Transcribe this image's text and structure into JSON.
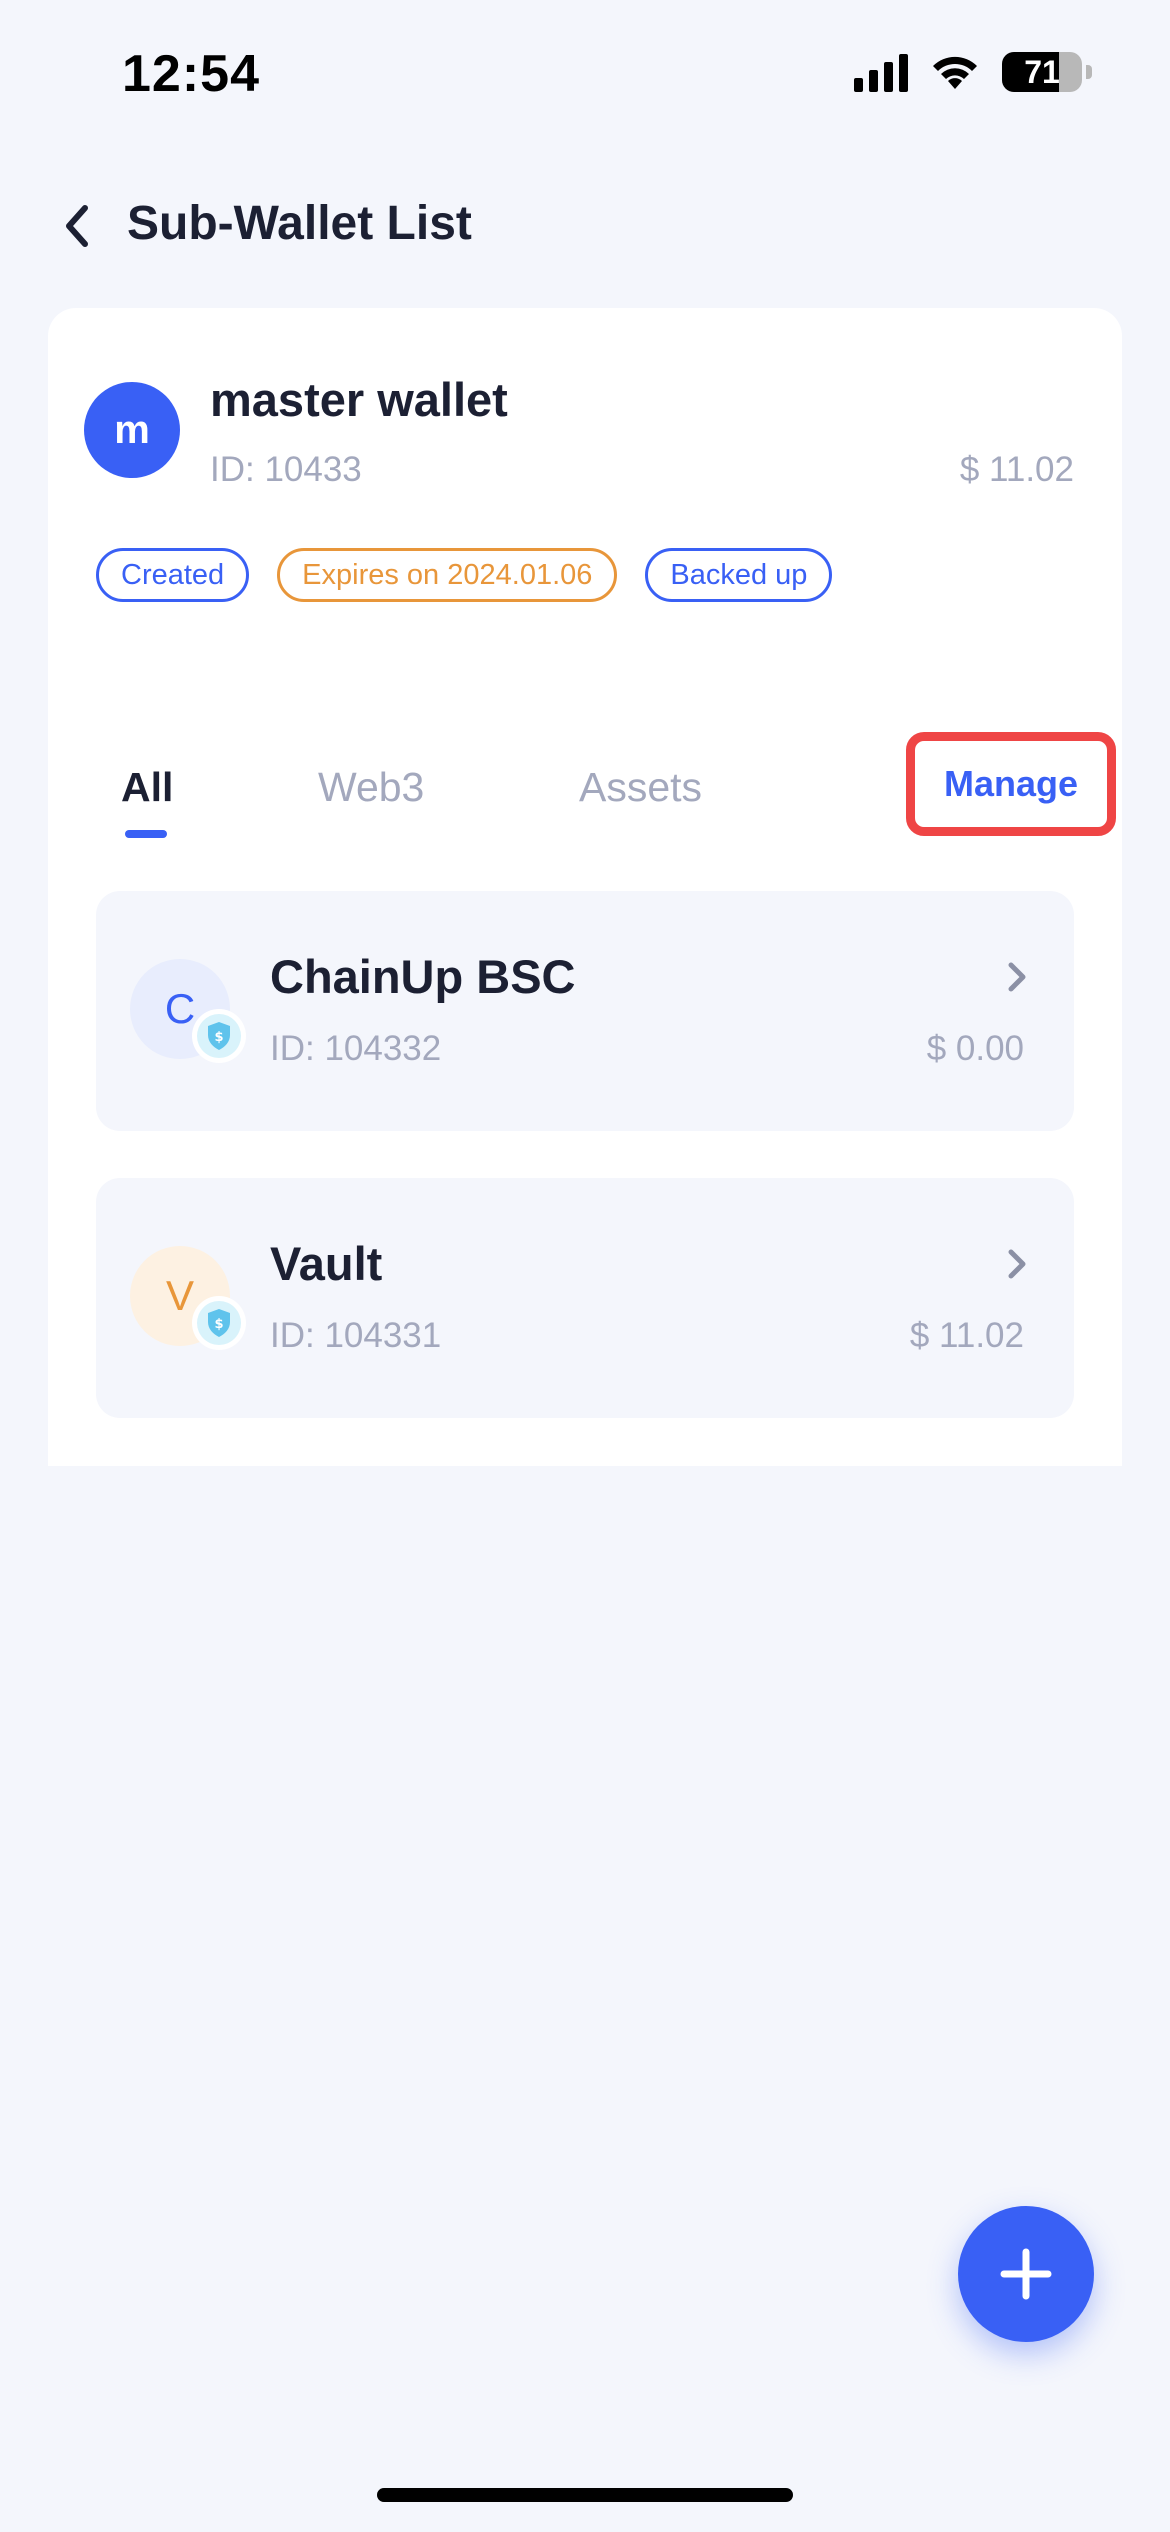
{
  "status_bar": {
    "time": "12:54",
    "battery": "71",
    "battery_level": 0.71
  },
  "nav": {
    "title": "Sub-Wallet List"
  },
  "master": {
    "avatar_letter": "m",
    "name": "master wallet",
    "id": "ID: 10433",
    "balance": "$ 11.02",
    "tags": [
      {
        "label": "Created",
        "color": "#3960f5"
      },
      {
        "label": "Expires on 2024.01.06",
        "color": "#e8963a"
      },
      {
        "label": "Backed up",
        "color": "#3960f5"
      }
    ]
  },
  "tabs": [
    {
      "label": "All",
      "active": true
    },
    {
      "label": "Web3",
      "active": false
    },
    {
      "label": "Assets",
      "active": false
    }
  ],
  "manage_label": "Manage",
  "wallets": [
    {
      "letter": "C",
      "letter_color": "#3960f5",
      "avatar_bg": "#e8edfd",
      "name": "ChainUp BSC",
      "id": "ID: 104332",
      "balance": "$ 0.00"
    },
    {
      "letter": "V",
      "letter_color": "#e8963a",
      "avatar_bg": "#fdf1e2",
      "name": "Vault",
      "id": "ID: 104331",
      "balance": "$ 11.02"
    }
  ],
  "colors": {
    "accent": "#3960f5",
    "highlight": "#ef4545",
    "muted_text": "#a3a8bd"
  },
  "icons": {
    "back": "chevron-left-icon",
    "chevron": "chevron-right-icon",
    "shield": "shield-dollar-icon",
    "add": "plus-icon",
    "signal": "cellular-signal-icon",
    "wifi": "wifi-icon",
    "battery": "battery-icon"
  }
}
